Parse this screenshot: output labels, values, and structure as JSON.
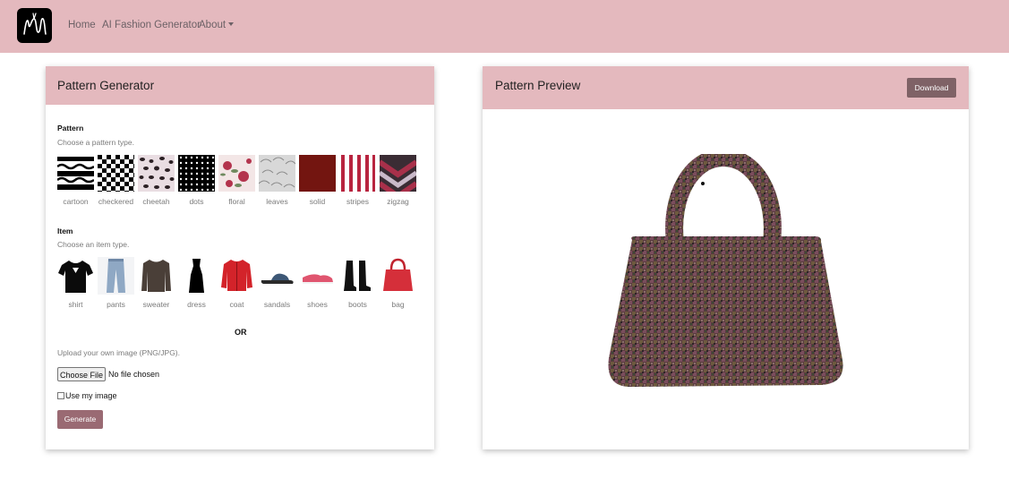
{
  "navbar": {
    "links": [
      "Home",
      "AI Fashion Generator",
      "About"
    ],
    "brand_icon": "sewing-logo-icon",
    "bg_color": "#e4b9be"
  },
  "generator": {
    "title": "Pattern Generator",
    "pattern_label": "Pattern",
    "pattern_hint": "Choose a pattern type.",
    "patterns": [
      "cartoon",
      "checkered",
      "cheetah",
      "dots",
      "floral",
      "leaves",
      "solid",
      "stripes",
      "zigzag"
    ],
    "item_label": "Item",
    "item_hint": "Choose an item type.",
    "items": [
      "shirt",
      "pants",
      "sweater",
      "dress",
      "coat",
      "sandals",
      "shoes",
      "boots",
      "bag"
    ],
    "or_text": "OR",
    "upload_hint": "Upload your own image (PNG/JPG).",
    "file_button": "Choose File",
    "file_status": "No file chosen",
    "use_image_label": "Use my image",
    "use_image_checked": false,
    "generate_label": "Generate",
    "button_color": "#9a6a73"
  },
  "preview": {
    "title": "Pattern Preview",
    "download_label": "Download",
    "image_icon": "patterned-handbag-image"
  }
}
